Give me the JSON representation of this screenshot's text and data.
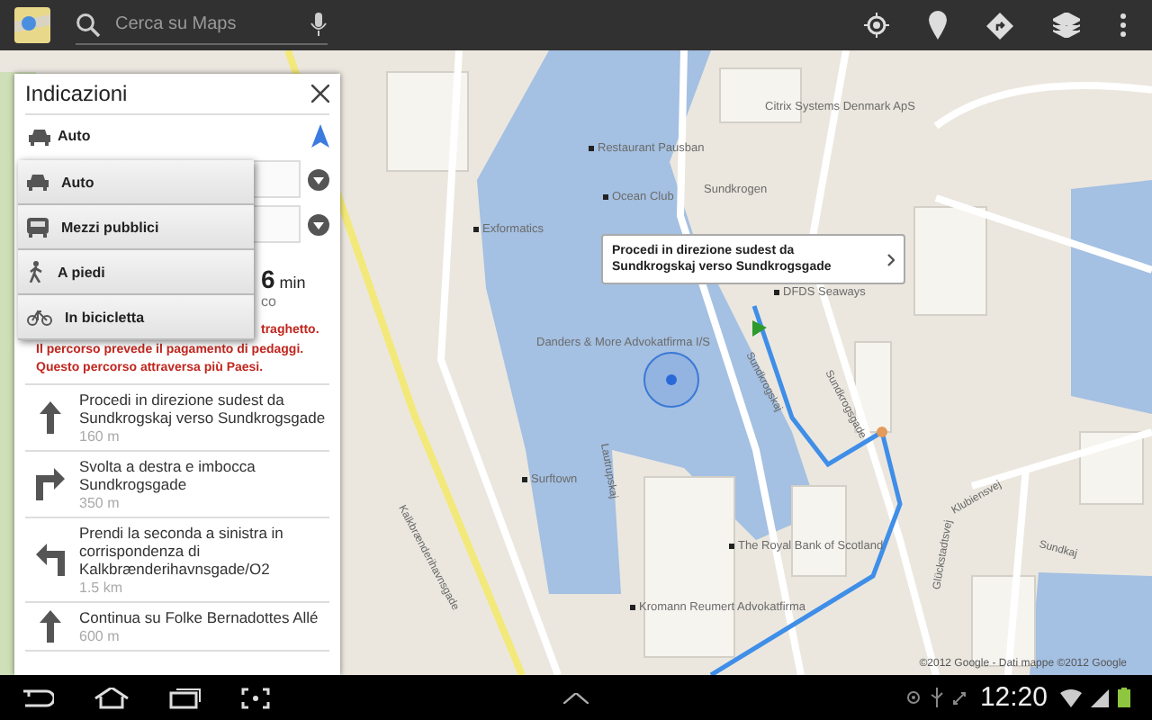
{
  "top_bar": {
    "search": {
      "placeholder": "Cerca su Maps"
    }
  },
  "panel": {
    "title": "Indicazioni",
    "mode": {
      "label": "Auto",
      "kind": "car"
    },
    "mode_menu": [
      {
        "label": "Auto",
        "kind": "car"
      },
      {
        "label": "Mezzi pubblici",
        "kind": "bus"
      },
      {
        "label": "A piedi",
        "kind": "walk"
      },
      {
        "label": "In bicicletta",
        "kind": "bike"
      }
    ],
    "summary": {
      "time": "6",
      "unit": "min",
      "subtitle": "co"
    },
    "warnings": [
      "traghetto.",
      "Il percorso prevede il pagamento di pedaggi.",
      "Questo percorso attraversa più Paesi."
    ],
    "steps": [
      {
        "kind": "straight",
        "text": "Procedi in direzione sudest da Sundkrogskaj verso Sundkrogsgade",
        "distance": "160 m"
      },
      {
        "kind": "right",
        "text": "Svolta a destra e imbocca Sundkrogsgade",
        "distance": "350 m"
      },
      {
        "kind": "left",
        "text": "Prendi la seconda a sinistra in corrispondenza di Kalkbrænderihavnsgade/O2",
        "distance": "1.5 km"
      },
      {
        "kind": "straight",
        "text": "Continua su Folke Bernadottes Allé",
        "distance": "600 m"
      }
    ]
  },
  "map": {
    "callout": "Procedi in direzione sudest da Sundkrogskaj verso Sundkrogsgade",
    "places": [
      {
        "name": "Citrix Systems Denmark ApS",
        "dot": false
      },
      {
        "name": "Restaurant Pausban",
        "dot": true
      },
      {
        "name": "Sundkrogen",
        "dot": false
      },
      {
        "name": "Ocean Club",
        "dot": true
      },
      {
        "name": "Exformatics",
        "dot": true
      },
      {
        "name": "DFDS Seaways",
        "dot": true
      },
      {
        "name": "Danders & More Advokatfirma I/S",
        "dot": false
      },
      {
        "name": "Surftown",
        "dot": true
      },
      {
        "name": "The Royal Bank of Scotland",
        "dot": true
      },
      {
        "name": "Kromann Reumert Advokatfirma",
        "dot": true
      }
    ],
    "streets": [
      "Sundkrogskaj",
      "Sundkrogsgade",
      "Kalkbrænderihavnsgade",
      "Lautrupskaj",
      "Klubiensvej",
      "Sundkaj",
      "Glückstadtsvej"
    ],
    "copyright": "©2012 Google - Dati mappe ©2012 Google"
  },
  "status_bar": {
    "time": "12:20"
  }
}
